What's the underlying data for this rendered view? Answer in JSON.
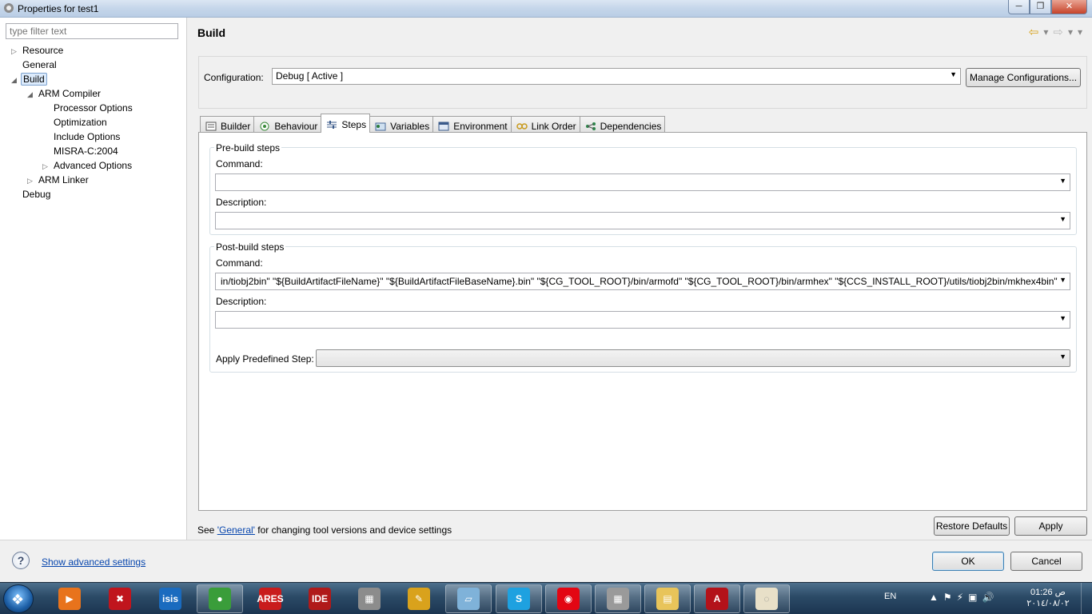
{
  "window": {
    "title": "Properties for test1",
    "minimize": "─",
    "maximize": "❐",
    "close": "✕"
  },
  "left": {
    "filter_placeholder": "type filter text",
    "tree": [
      {
        "label": "Resource",
        "expander": "▷"
      },
      {
        "label": "General",
        "expander": ""
      },
      {
        "label": "Build",
        "expander": "◢",
        "selected": true
      },
      {
        "label": "ARM Compiler",
        "expander": "◢"
      },
      {
        "label": "Processor Options",
        "expander": ""
      },
      {
        "label": "Optimization",
        "expander": ""
      },
      {
        "label": "Include Options",
        "expander": ""
      },
      {
        "label": "MISRA-C:2004",
        "expander": ""
      },
      {
        "label": "Advanced Options",
        "expander": "▷"
      },
      {
        "label": "ARM Linker",
        "expander": "▷"
      },
      {
        "label": "Debug",
        "expander": ""
      }
    ]
  },
  "main": {
    "title": "Build",
    "configuration_label": "Configuration:",
    "configuration_value": "Debug  [ Active ]",
    "manage_button": "Manage Configurations...",
    "tabs": [
      {
        "label": "Builder",
        "icon": "builder-icon"
      },
      {
        "label": "Behaviour",
        "icon": "behaviour-icon"
      },
      {
        "label": "Steps",
        "icon": "steps-icon",
        "active": true
      },
      {
        "label": "Variables",
        "icon": "variables-icon"
      },
      {
        "label": "Environment",
        "icon": "environment-icon"
      },
      {
        "label": "Link Order",
        "icon": "link-order-icon"
      },
      {
        "label": "Dependencies",
        "icon": "dependencies-icon"
      }
    ],
    "pre_build": {
      "title": "Pre-build steps",
      "command_label": "Command:",
      "command_value": "",
      "description_label": "Description:",
      "description_value": ""
    },
    "post_build": {
      "title": "Post-build steps",
      "command_label": "Command:",
      "command_value": "in/tiobj2bin\" \"${BuildArtifactFileName}\" \"${BuildArtifactFileBaseName}.bin\" \"${CG_TOOL_ROOT}/bin/armofd\" \"${CG_TOOL_ROOT}/bin/armhex\" \"${CCS_INSTALL_ROOT}/utils/tiobj2bin/mkhex4bin\"",
      "description_label": "Description:",
      "description_value": "",
      "apply_label": "Apply Predefined Step:",
      "apply_value": ""
    },
    "footer_prefix": "See ",
    "footer_link": "'General'",
    "footer_suffix": " for changing tool versions and device settings",
    "restore_button": "Restore Defaults",
    "apply_button": "Apply"
  },
  "bottom": {
    "help_symbol": "?",
    "advanced_link": "Show advanced settings",
    "ok_button": "OK",
    "cancel_button": "Cancel"
  },
  "taskbar": {
    "start_symbol": "❖",
    "apps": [
      {
        "name": "media-player",
        "text": "▶",
        "color": "#e8731c",
        "open": false
      },
      {
        "name": "ares-red",
        "text": "✖",
        "color": "#c0151d",
        "open": false
      },
      {
        "name": "isis",
        "text": "isis",
        "color": "#1a6bbf",
        "open": false
      },
      {
        "name": "chrome",
        "text": "●",
        "color": "#3a9d3a",
        "open": true
      },
      {
        "name": "ares",
        "text": "ARES",
        "color": "#c91c1c",
        "open": false
      },
      {
        "name": "mplab",
        "text": "IDE",
        "color": "#b01a1a",
        "open": false
      },
      {
        "name": "virtualbox",
        "text": "▦",
        "color": "#8c8c8c",
        "open": false
      },
      {
        "name": "tools",
        "text": "✎",
        "color": "#d9a21c",
        "open": false
      },
      {
        "name": "notepad",
        "text": "▱",
        "color": "#7fb2d9",
        "open": true
      },
      {
        "name": "skype",
        "text": "S",
        "color": "#1ea1e0",
        "open": true
      },
      {
        "name": "vodafone",
        "text": "◉",
        "color": "#e30613",
        "open": true
      },
      {
        "name": "ccs",
        "text": "▦",
        "color": "#9a9a9a",
        "open": true
      },
      {
        "name": "explorer",
        "text": "▤",
        "color": "#e8c45a",
        "open": true
      },
      {
        "name": "acrobat",
        "text": "A",
        "color": "#b3121a",
        "open": true
      },
      {
        "name": "loading",
        "text": "◌",
        "color": "#e8e0c8",
        "open": true
      }
    ],
    "lang": "EN",
    "time": "01:26 ص",
    "date": "٢٠١٤/٠٨/٠٢"
  }
}
